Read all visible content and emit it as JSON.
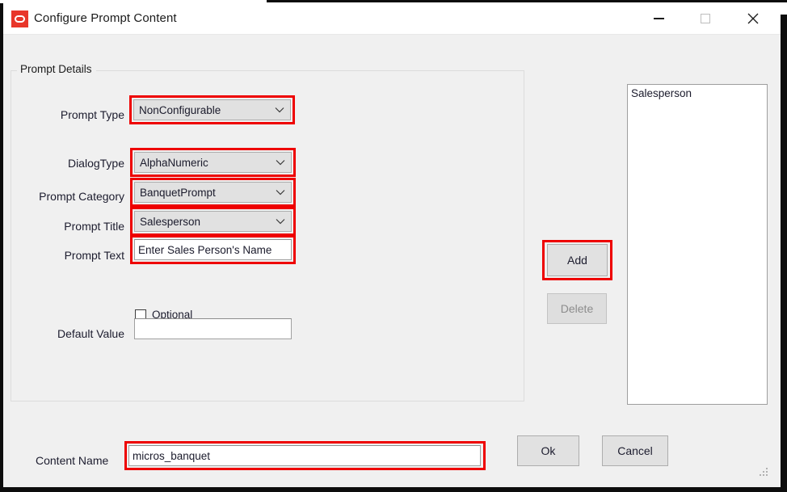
{
  "window": {
    "title": "Configure Prompt Content",
    "app_icon": "oracle-logo-icon",
    "controls": {
      "minimize": "minimize-icon",
      "maximize": "maximize-icon",
      "close": "close-icon"
    }
  },
  "group": {
    "legend": "Prompt Details"
  },
  "form": {
    "prompt_type": {
      "label": "Prompt Type",
      "value": "NonConfigurable",
      "highlighted": true
    },
    "dialog_type": {
      "label": "DialogType",
      "value": "AlphaNumeric",
      "highlighted": true
    },
    "prompt_category": {
      "label": "Prompt Category",
      "value": "BanquetPrompt",
      "highlighted": true
    },
    "prompt_title": {
      "label": "Prompt Title",
      "value": "Salesperson",
      "highlighted": true
    },
    "prompt_text": {
      "label": "Prompt Text",
      "value": "Enter Sales Person's Name",
      "highlighted": true
    },
    "optional": {
      "label": "Optional",
      "checked": false
    },
    "default_value": {
      "label": "Default Value",
      "value": "",
      "highlighted": false
    }
  },
  "side": {
    "add_label": "Add",
    "delete_label": "Delete",
    "list_items": [
      "Salesperson"
    ]
  },
  "bottom": {
    "content_name_label": "Content Name",
    "content_name_value": "micros_banquet",
    "ok_label": "Ok",
    "cancel_label": "Cancel"
  },
  "colors": {
    "highlight": "#ee0000",
    "accent": "#e8362a",
    "window_bg": "#f0f0f0",
    "field_bg": "#e1e1e1",
    "input_bg": "#ffffff"
  }
}
